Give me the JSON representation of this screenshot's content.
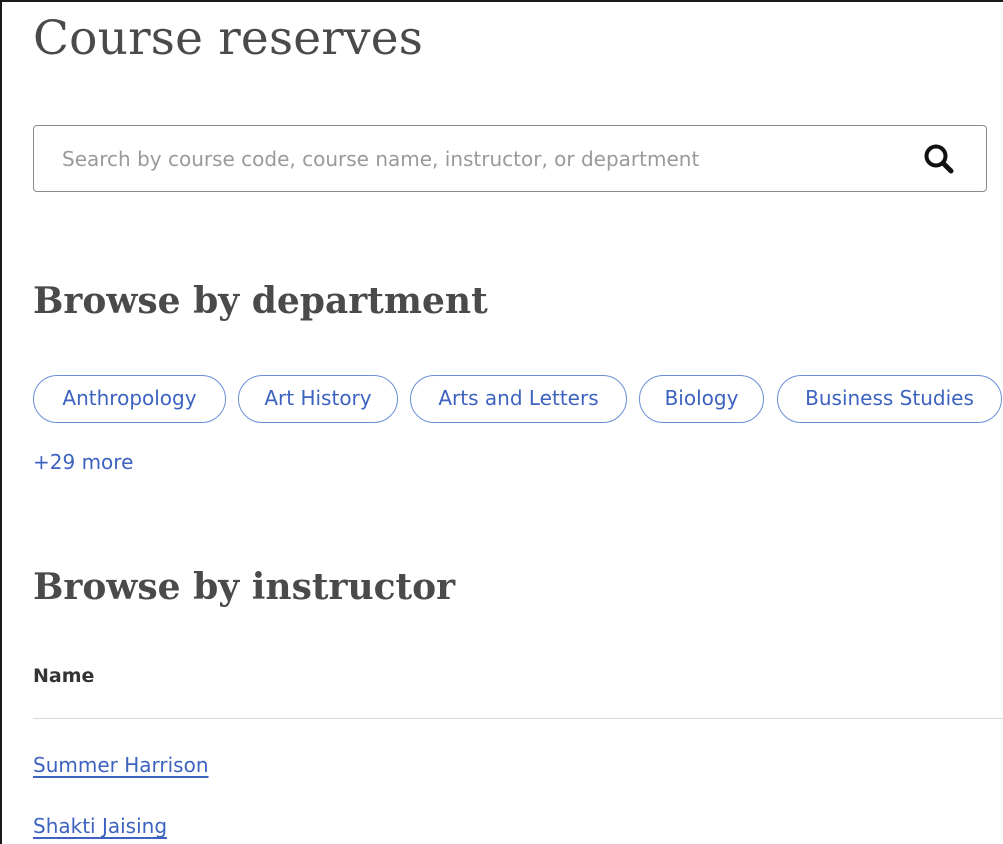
{
  "page": {
    "title": "Course reserves"
  },
  "search": {
    "placeholder": "Search by course code, course name, instructor, or department",
    "value": "",
    "button_icon": "search-icon"
  },
  "departments": {
    "heading": "Browse by department",
    "items": [
      {
        "label": "Anthropology"
      },
      {
        "label": "Art History"
      },
      {
        "label": "Arts and Letters"
      },
      {
        "label": "Biology"
      },
      {
        "label": "Business Studies"
      }
    ],
    "more_label": "+29 more"
  },
  "instructors": {
    "heading": "Browse by instructor",
    "column_header": "Name",
    "items": [
      {
        "name": "Summer Harrison"
      },
      {
        "name": "Shakti Jaising"
      }
    ]
  },
  "colors": {
    "accent": "#3d63c0",
    "chip_border": "#6b8fd6",
    "heading": "#4a4a4a"
  }
}
